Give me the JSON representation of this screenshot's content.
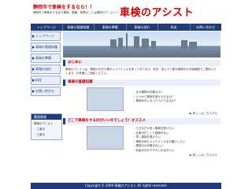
{
  "header": {
    "tagline": "静岡市で車検をするなら！！",
    "subtag": "静岡市で車検をするなら車検、整備、修理のことは車検のアシストへ",
    "site_title": "車検のアシスト"
  },
  "nav": [
    "トップページ",
    "車検の基礎知識",
    "車検の準備",
    "車検の流れ",
    "料金",
    "お問い合わせ"
  ],
  "sidebar": {
    "items": [
      "トップページ",
      "車検の基礎知識",
      "車検の準備",
      "車検の流れ",
      "料金",
      "お問い合わせ"
    ],
    "box": {
      "title": "関連情報",
      "lines": [
        "車検のアシスト",
        "・工事中",
        "・工事中"
      ]
    }
  },
  "sections": {
    "intro_title": "はじめに",
    "intro_text": "車検のアシストは、車検の代行や車のメンテナンスを承っております。安全・安心で丁寧な車検をお手頃価格でご提供いたします。お気軽にご相談ください。",
    "basic_title": "車検の基礎知識",
    "basic_bullets": [
      "・なぜ車検が必要なの？",
      "・いつから車検を受けられるの？",
      "・車検切れになったらどうなるの？"
    ],
    "recommend_title": "どこで車検をするのがいいのでしょう？オススメ",
    "recommend_bullets": [
      "・できるだけ安く車検を受けたい",
      "・仕事が忙しくて時間がない",
      "・早く車検を受けたい",
      "・車検の後もメンテナンスをお願いしたい",
      "・車検中の代車がほしい",
      "・料金が分かりやすいお店がいい"
    ],
    "more_label": "詳しくはこちらから"
  },
  "footer": {
    "text": "Copyright © 2009 車検のアシスト All rights reserved."
  }
}
